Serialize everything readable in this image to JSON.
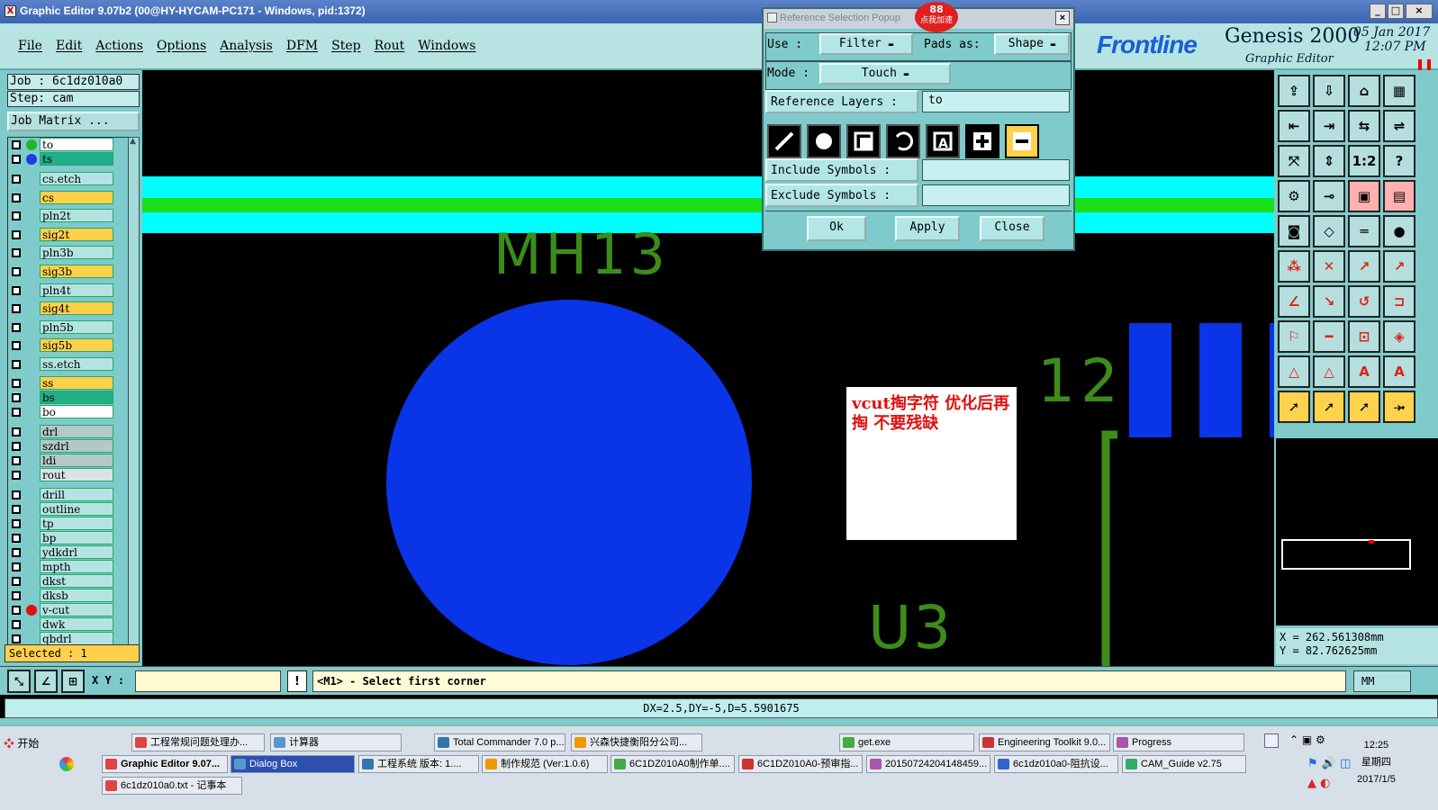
{
  "window": {
    "title": "Graphic Editor 9.07b2 (00@HY-HYCAM-PC171 - Windows, pid:1372)",
    "app_icon": "X"
  },
  "menu": [
    "File",
    "Edit",
    "Actions",
    "Options",
    "Analysis",
    "DFM",
    "Step",
    "Rout",
    "Windows"
  ],
  "brand": {
    "logo": "Frontline",
    "product": "Genesis 2000",
    "subtitle": "Graphic Editor",
    "date": "05 Jan 2017",
    "time": "12:07 PM"
  },
  "left": {
    "job": "Job : 6c1dz010a0",
    "step": "Step: cam",
    "matrix_button": "Job Matrix ...",
    "selected": "Selected : 1",
    "layers": [
      {
        "name": "to",
        "color": "#ffffff",
        "dot": "#1fb81f"
      },
      {
        "name": "ts",
        "color": "#1fb08a",
        "dot": "#1e3be6"
      },
      {
        "name": "cs.etch",
        "color": "#b5e3e3",
        "dot": ""
      },
      {
        "name": "cs",
        "color": "#ffd14a",
        "dot": ""
      },
      {
        "name": "pln2t",
        "color": "#b5e3e3",
        "dot": ""
      },
      {
        "name": "sig2t",
        "color": "#ffd14a",
        "dot": ""
      },
      {
        "name": "pln3b",
        "color": "#b5e3e3",
        "dot": ""
      },
      {
        "name": "sig3b",
        "color": "#ffd14a",
        "dot": ""
      },
      {
        "name": "pln4t",
        "color": "#b5e3e3",
        "dot": ""
      },
      {
        "name": "sig4t",
        "color": "#ffd14a",
        "dot": ""
      },
      {
        "name": "pln5b",
        "color": "#b5e3e3",
        "dot": ""
      },
      {
        "name": "sig5b",
        "color": "#ffd14a",
        "dot": ""
      },
      {
        "name": "ss.etch",
        "color": "#b5e3e3",
        "dot": ""
      },
      {
        "name": "ss",
        "color": "#ffd14a",
        "dot": ""
      },
      {
        "name": "bs",
        "color": "#1fb08a",
        "dot": ""
      },
      {
        "name": "bo",
        "color": "#ffffff",
        "dot": ""
      },
      {
        "name": "drl",
        "color": "#b5c8c8",
        "dot": ""
      },
      {
        "name": "szdrl",
        "color": "#b5c8c8",
        "dot": ""
      },
      {
        "name": "ldi",
        "color": "#b5c8c8",
        "dot": ""
      },
      {
        "name": "rout",
        "color": "#d9e4e4",
        "dot": ""
      },
      {
        "name": "drill",
        "color": "#b5e3e3",
        "dot": ""
      },
      {
        "name": "outline",
        "color": "#b5e3e3",
        "dot": ""
      },
      {
        "name": "tp",
        "color": "#b5e3e3",
        "dot": ""
      },
      {
        "name": "bp",
        "color": "#b5e3e3",
        "dot": ""
      },
      {
        "name": "ydkdrl",
        "color": "#b5e3e3",
        "dot": ""
      },
      {
        "name": "mpth",
        "color": "#b5e3e3",
        "dot": ""
      },
      {
        "name": "dkst",
        "color": "#b5e3e3",
        "dot": ""
      },
      {
        "name": "dksb",
        "color": "#b5e3e3",
        "dot": ""
      },
      {
        "name": "v-cut",
        "color": "#b5e3e3",
        "dot": "#e01010"
      },
      {
        "name": "dwk",
        "color": "#b5e3e3",
        "dot": ""
      },
      {
        "name": "qbdrl",
        "color": "#b5e3e3",
        "dot": ""
      }
    ]
  },
  "canvas": {
    "labels": {
      "mh13": "MH13",
      "n12": "12",
      "u3": "U3"
    },
    "note": "vcut掏字符  优化后再掏  不要残缺",
    "colors": {
      "cyan": "#00ffff",
      "green": "#1adf1a",
      "blue": "#0a34e8",
      "silk": "#3d8c1a"
    }
  },
  "coords": {
    "x": "X = 262.561308mm",
    "y": "Y = 82.762625mm"
  },
  "cmd": {
    "xy_label": "X Y :",
    "prompt": "<M1> - Select first corner",
    "units": "MM",
    "alert": "!"
  },
  "status": "DX=2.5,DY=-5,D=5.5901675",
  "dialog": {
    "title": "Reference Selection Popup",
    "use_label": "Use   :",
    "use_value": "Filter",
    "pads_label": "Pads as:",
    "pads_value": "Shape",
    "mode_label": "Mode  :",
    "mode_value": "Touch",
    "ref_layers_label": "Reference Layers :",
    "ref_layers_value": "to",
    "include_label": "Include Symbols :",
    "exclude_label": "Exclude Symbols :",
    "ok": "Ok",
    "apply": "Apply",
    "close": "Close",
    "badge_count": "88",
    "badge_text": "点我加速"
  },
  "taskbar": {
    "start": "开始",
    "row1": [
      "工程常规问题处理办...",
      "计算器",
      "Total Commander 7.0 p...",
      "兴森快捷衡阳分公司...",
      "get.exe",
      "Engineering Toolkit 9.0...",
      "Progress"
    ],
    "row2": [
      "Graphic Editor 9.07...",
      "Dialog Box",
      "工程系统  版本: 1....",
      "制作规范 (Ver:1.0.6)",
      "6C1DZ010A0制作单....",
      "6C1DZ010A0-预审指...",
      "2015072420414845​9...",
      "6c1dz010a0-阻抗设...",
      "CAM_Guide v2.75"
    ],
    "row3": [
      "6c1dz010a0.txt - 记事本"
    ],
    "clock_time": "12:25",
    "clock_day": "星期四",
    "clock_date": "2017/1/5"
  }
}
